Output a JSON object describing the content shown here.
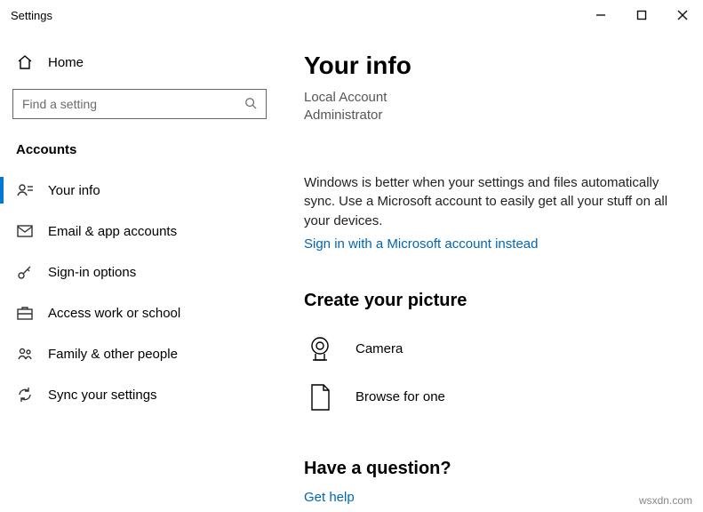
{
  "window": {
    "title": "Settings"
  },
  "sidebar": {
    "home": "Home",
    "search_placeholder": "Find a setting",
    "section": "Accounts",
    "items": [
      {
        "label": "Your info"
      },
      {
        "label": "Email & app accounts"
      },
      {
        "label": "Sign-in options"
      },
      {
        "label": "Access work or school"
      },
      {
        "label": "Family & other people"
      },
      {
        "label": "Sync your settings"
      }
    ]
  },
  "main": {
    "heading": "Your info",
    "account_type_1": "Local Account",
    "account_type_2": "Administrator",
    "sync_blurb": "Windows is better when your settings and files automatically sync. Use a Microsoft account to easily get all your stuff on all your devices.",
    "signin_link": "Sign in with a Microsoft account instead",
    "picture_heading": "Create your picture",
    "camera_label": "Camera",
    "browse_label": "Browse for one",
    "question_heading": "Have a question?",
    "get_help": "Get help"
  },
  "watermark": "wsxdn.com"
}
